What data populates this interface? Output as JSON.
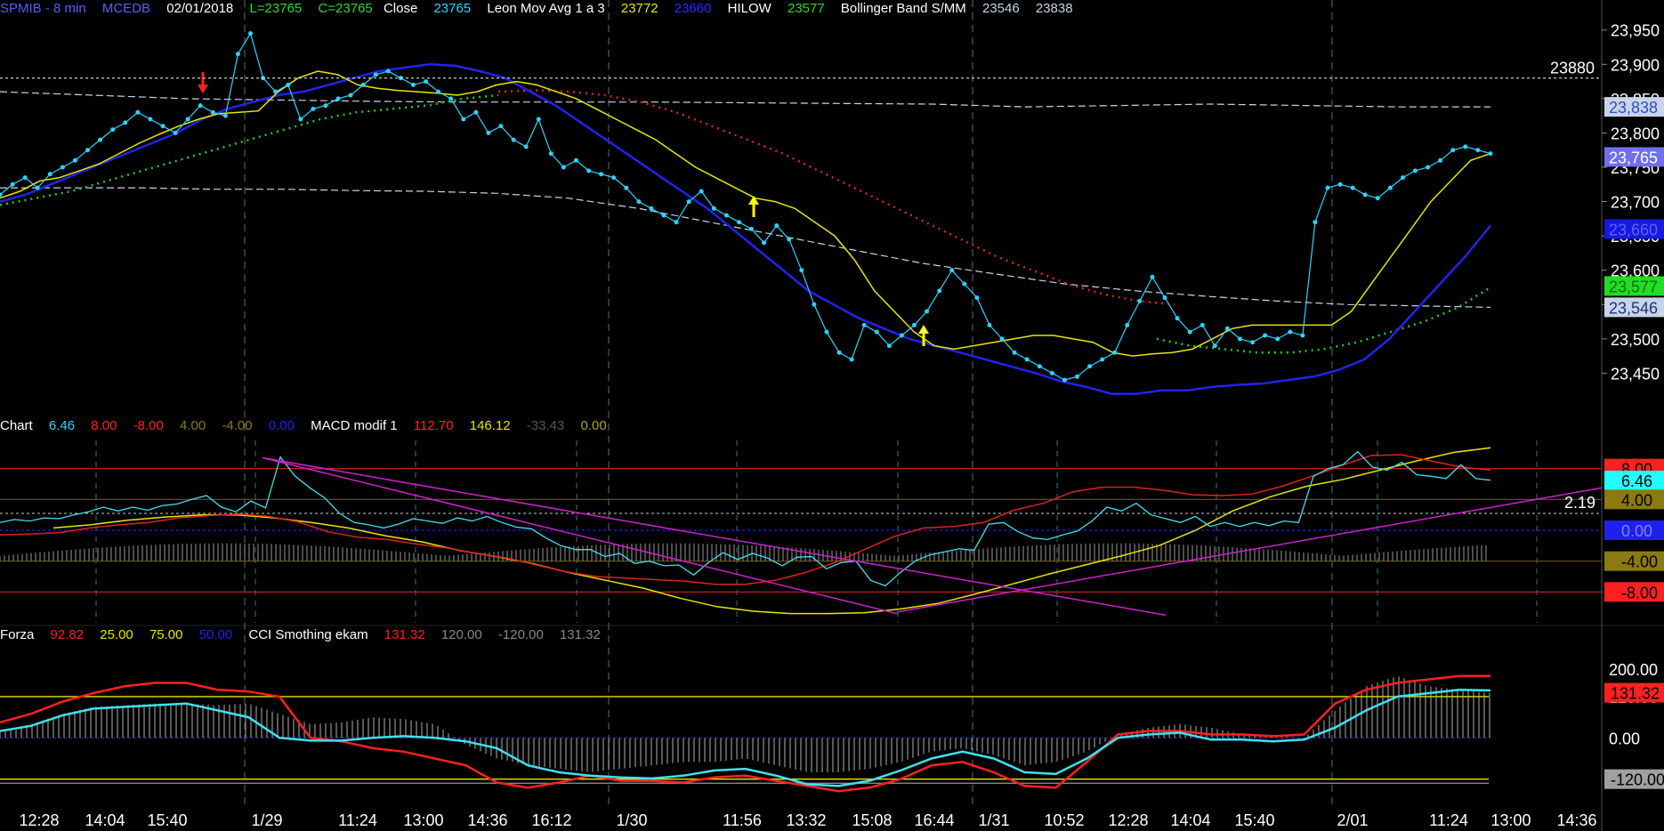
{
  "colors": {
    "background": "#000000",
    "grid": "#3a4a50",
    "price": "#2ad4ff",
    "leon": "#e6e600",
    "hilow": "#2222ee",
    "boll_up": "#dd2222",
    "boll_dn": "#22cc22",
    "band": "#c8d4e8",
    "magenta": "#d020d0",
    "cci": "#40e0f0",
    "forza_red": "#ff2020",
    "histogram": "#b0b0b0",
    "macd_red": "#dd2222"
  },
  "header_top": {
    "symbol": "SPMIB - 8 min",
    "exchange": "MCEDB",
    "date": "02/01/2018",
    "low": "L=23765",
    "close_lbl": "C=23765",
    "close_word": "Close",
    "close_val": "23765",
    "leon": "Leon Mov Avg 1 a 3",
    "leon_v1": "23772",
    "leon_v2": "23660",
    "hilow": "HILOW",
    "hilow_v": "23577",
    "boll": "Bollinger Band S/MM",
    "boll_v1": "23546",
    "boll_v2": "23838"
  },
  "header_mid": {
    "name": "Chart",
    "v1": "6.46",
    "v2": "8.00",
    "v3": "-8.00",
    "v4": "4.00",
    "v5": "-4.00",
    "v6": "0.00",
    "name2": "MACD modif 1",
    "m1": "112.70",
    "m2": "146.12",
    "m3": "-33.43",
    "m4": "0.00"
  },
  "header_bot": {
    "name": "Forza",
    "f1": "92.82",
    "f2": "25.00",
    "f3": "75.00",
    "f4": "50.00",
    "name2": "CCI Smothing ekam",
    "c1": "131.32",
    "c2": "120.00",
    "c3": "-120.00",
    "c4": "131.32"
  },
  "x_axis_labels": [
    "12:28",
    "14:04",
    "15:40",
    "1/29",
    "11:24",
    "13:00",
    "14:36",
    "16:12",
    "1/30",
    "11:56",
    "13:32",
    "15:08",
    "16:44",
    "1/31",
    "10:52",
    "12:28",
    "14:04",
    "15:40",
    "2/01",
    "11:24",
    "13:00",
    "14:36"
  ],
  "chart_data": [
    {
      "type": "line",
      "panel": "price",
      "ylim": [
        23400,
        23960
      ],
      "y_ticks": [
        "23,950",
        "23,900",
        "23,850",
        "23,800",
        "23,750",
        "23,700",
        "23,650",
        "23,600",
        "23,550",
        "23,500",
        "23,450"
      ],
      "reference_line": {
        "value": 23880,
        "label": "23880"
      },
      "price_tags": [
        {
          "value": 23838,
          "label": "23,838",
          "color": "#c8d4e8",
          "text": "#3050c0"
        },
        {
          "value": 23765,
          "label": "23,765",
          "color": "#7070ee",
          "text": "#ffffff"
        },
        {
          "value": 23660,
          "label": "23,660",
          "color": "#1818e0",
          "text": "#6060ff"
        },
        {
          "value": 23577,
          "label": "23,577",
          "color": "#22dd22",
          "text": "#107010"
        },
        {
          "value": 23546,
          "label": "23,546",
          "color": "#c8d4e8",
          "text": "#203080"
        }
      ],
      "series": [
        {
          "key": "close",
          "style": "dots",
          "values": [
            23710,
            23725,
            23735,
            23720,
            23740,
            23750,
            23760,
            23775,
            23790,
            23805,
            23815,
            23830,
            23820,
            23810,
            23800,
            23820,
            23840,
            23830,
            23825,
            23915,
            23945,
            23880,
            23860,
            23870,
            23820,
            23835,
            23840,
            23850,
            23855,
            23870,
            23885,
            23890,
            23880,
            23870,
            23875,
            23860,
            23850,
            23820,
            23830,
            23800,
            23810,
            23790,
            23780,
            23820,
            23770,
            23750,
            23760,
            23745,
            23740,
            23735,
            23720,
            23700,
            23690,
            23680,
            23670,
            23700,
            23715,
            23690,
            23680,
            23670,
            23660,
            23640,
            23665,
            23645,
            23600,
            23550,
            23510,
            23480,
            23470,
            23520,
            23510,
            23490,
            23505,
            23520,
            23540,
            23570,
            23600,
            23580,
            23560,
            23520,
            23500,
            23480,
            23470,
            23460,
            23450,
            23440,
            23445,
            23460,
            23470,
            23480,
            23520,
            23555,
            23590,
            23560,
            23530,
            23510,
            23520,
            23490,
            23515,
            23500,
            23495,
            23505,
            23500,
            23510,
            23505,
            23670,
            23720,
            23725,
            23720,
            23710,
            23705,
            23720,
            23735,
            23745,
            23750,
            23760,
            23775,
            23780,
            23775,
            23770
          ]
        },
        {
          "key": "leon",
          "style": "solid",
          "values": [
            23705,
            23715,
            23730,
            23735,
            23745,
            23755,
            23770,
            23785,
            23798,
            23810,
            23820,
            23828,
            23830,
            23832,
            23860,
            23880,
            23890,
            23885,
            23870,
            23865,
            23862,
            23860,
            23858,
            23855,
            23860,
            23870,
            23875,
            23870,
            23860,
            23850,
            23835,
            23820,
            23805,
            23790,
            23770,
            23750,
            23735,
            23720,
            23705,
            23700,
            23690,
            23670,
            23650,
            23615,
            23570,
            23540,
            23510,
            23490,
            23485,
            23490,
            23495,
            23500,
            23505,
            23505,
            23500,
            23495,
            23480,
            23475,
            23478,
            23480,
            23485,
            23500,
            23515,
            23520,
            23520,
            23520,
            23520,
            23520,
            23540,
            23580,
            23620,
            23660,
            23700,
            23730,
            23760,
            23770
          ]
        },
        {
          "key": "hilow",
          "style": "solid",
          "values": [
            23700,
            23710,
            23725,
            23740,
            23755,
            23770,
            23785,
            23800,
            23820,
            23835,
            23845,
            23855,
            23860,
            23870,
            23880,
            23890,
            23895,
            23900,
            23898,
            23890,
            23880,
            23860,
            23840,
            23815,
            23790,
            23765,
            23740,
            23715,
            23690,
            23660,
            23630,
            23600,
            23570,
            23550,
            23530,
            23515,
            23500,
            23490,
            23480,
            23470,
            23460,
            23450,
            23438,
            23430,
            23420,
            23420,
            23425,
            23425,
            23430,
            23433,
            23435,
            23440,
            23445,
            23455,
            23470,
            23500,
            23540,
            23580,
            23620,
            23665
          ]
        },
        {
          "key": "boll_up",
          "style": "dotted",
          "values": [
            23860,
            23862,
            23860,
            23855,
            23845,
            23830,
            23810,
            23790,
            23770,
            23745,
            23720,
            23695,
            23670,
            23645,
            23620,
            23600,
            23580,
            23565,
            23555,
            23550
          ]
        },
        {
          "key": "boll_dn",
          "style": "dotted",
          "values": [
            23695,
            23705,
            23715,
            23730,
            23745,
            23760,
            23775,
            23790,
            23805,
            23820,
            23830,
            23835,
            23840,
            23850,
            23855
          ]
        },
        {
          "key": "boll_dn2",
          "style": "dotted",
          "values": [
            23500,
            23490,
            23485,
            23480,
            23480,
            23485,
            23495,
            23510,
            23525,
            23545,
            23575
          ]
        },
        {
          "key": "band_upper",
          "style": "dashed",
          "values": [
            23860,
            23855,
            23850,
            23848,
            23846,
            23845,
            23845,
            23845,
            23844,
            23843,
            23842,
            23838,
            23840,
            23842,
            23840,
            23838,
            23838
          ]
        },
        {
          "key": "band_lower",
          "style": "dashed",
          "values": [
            23720,
            23720,
            23720,
            23718,
            23718,
            23716,
            23715,
            23712,
            23705,
            23690,
            23670,
            23650,
            23630,
            23610,
            23595,
            23580,
            23570,
            23562,
            23555,
            23550,
            23548,
            23546
          ]
        }
      ],
      "markers": [
        {
          "type": "down-arrow",
          "color": "#ff2020"
        },
        {
          "type": "up-arrow",
          "color": "#ffff00"
        },
        {
          "type": "up-arrow",
          "color": "#ffff00"
        }
      ]
    },
    {
      "type": "line",
      "panel": "chart_macd",
      "ylim": [
        -12,
        12
      ],
      "y_ticks": [
        {
          "value": 8,
          "label": "8.00",
          "bg": "#ff2020",
          "fg": "#000000"
        },
        {
          "value": 6.46,
          "label": "6.46",
          "bg": "#22ffff",
          "fg": "#000000"
        },
        {
          "value": 4,
          "label": "4.00",
          "bg": "#8a7a10",
          "fg": "#000000"
        },
        {
          "value": 0,
          "label": "0.00",
          "bg": "#2020ee",
          "fg": "#8080ff"
        },
        {
          "value": -4,
          "label": "-4.00",
          "bg": "#8a7a10",
          "fg": "#000000"
        },
        {
          "value": -8,
          "label": "-8.00",
          "bg": "#ff2020",
          "fg": "#000000"
        }
      ],
      "reference_line": {
        "value": 2.19,
        "label": "2.19"
      },
      "series": [
        {
          "key": "cyan",
          "values": [
            1,
            1.4,
            1.2,
            1.6,
            1.5,
            2,
            2.4,
            3,
            2.5,
            3,
            2.6,
            3.2,
            3.4,
            4,
            4.5,
            3,
            2.4,
            3.8,
            2.9,
            9.5,
            7,
            5.5,
            4.2,
            2.2,
            1,
            0.7,
            0.3,
            0.8,
            1.5,
            1.2,
            0.9,
            1.6,
            1.2,
            1.8,
            1,
            0.4,
            0.2,
            -1,
            -2,
            -2.5,
            -2.5,
            -3.4,
            -3,
            -4.3,
            -4,
            -4.6,
            -4.5,
            -5.8,
            -4.2,
            -2.9,
            -3.8,
            -3,
            -3.6,
            -4.6,
            -3.5,
            -3.4,
            -5,
            -4.2,
            -4,
            -6.5,
            -7.2,
            -5.5,
            -4,
            -3.2,
            -2.8,
            -2.4,
            -2.6,
            0.8,
            1,
            -0.2,
            -1,
            -1.2,
            -0.6,
            -0.1,
            1.2,
            3,
            2.5,
            3.5,
            2,
            1.5,
            1,
            1.8,
            0.5,
            1,
            0.5,
            1,
            0.6,
            1.2,
            1,
            7,
            8,
            8.5,
            10.2,
            8.2,
            7.8,
            8.8,
            7.2,
            7,
            6.7,
            8.5,
            6.7,
            6.5
          ]
        },
        {
          "key": "red",
          "values": [
            -0.6,
            -0.5,
            -0.3,
            0.3,
            0.7,
            1,
            1.6,
            1.9,
            2.1,
            1.8,
            1.1,
            -0.2,
            -0.9,
            -1.2,
            -1.8,
            -2.3,
            -3,
            -3.6,
            -4.5,
            -5.4,
            -6,
            -6.2,
            -6.4,
            -6.6,
            -7,
            -7,
            -6.5,
            -5.5,
            -4.2,
            -2.5,
            -0.8,
            0.3,
            0.5,
            1,
            2.6,
            3.5,
            5,
            5.6,
            5.6,
            5.2,
            4.6,
            4.5,
            4.7,
            5.7,
            7,
            8.4,
            9.7,
            9.8,
            9,
            8.2,
            7.8
          ]
        },
        {
          "key": "yellow",
          "values": [
            0.3,
            0.7,
            1.3,
            1.7,
            2,
            2,
            1.6,
            1,
            0.3,
            -0.7,
            -1.5,
            -2.6,
            -3.4,
            -4.3,
            -5.5,
            -6.5,
            -7.5,
            -8.8,
            -9.9,
            -10.5,
            -10.8,
            -10.8,
            -10.7,
            -10.2,
            -9.5,
            -8.3,
            -7,
            -5.7,
            -4.5,
            -3.3,
            -2,
            0,
            2.5,
            4.3,
            5.7,
            6.6,
            7.8,
            9,
            10.1,
            10.7
          ]
        },
        {
          "key": "magenta1",
          "values": [
            9.4,
            -10.8
          ]
        },
        {
          "key": "magenta2",
          "values": [
            9.4,
            -11
          ]
        },
        {
          "key": "magenta3",
          "values": [
            -10.6,
            5.5
          ]
        }
      ]
    },
    {
      "type": "line",
      "panel": "forza_cci",
      "ylim": [
        -170,
        270
      ],
      "y_ticks": [
        {
          "value": 200,
          "label": "200.00"
        },
        {
          "value": 120,
          "label": "120.00"
        },
        {
          "value": 0,
          "label": "0.00"
        },
        {
          "value": -120,
          "label": "-120.00"
        }
      ],
      "value_tags": [
        {
          "value": 131.32,
          "label": "131.32",
          "bg": "#ff2020",
          "fg": "#000000"
        },
        {
          "value": -120,
          "label": "-120.00",
          "bg": "#a0a0a0",
          "fg": "#000000"
        }
      ],
      "series": [
        {
          "key": "cci",
          "values": [
            20,
            35,
            65,
            85,
            90,
            95,
            100,
            80,
            60,
            0,
            -8,
            -8,
            0,
            5,
            0,
            -10,
            -30,
            -80,
            -100,
            -110,
            -115,
            -118,
            -110,
            -95,
            -90,
            -110,
            -135,
            -140,
            -125,
            -95,
            -60,
            -40,
            -60,
            -100,
            -105,
            -60,
            0,
            10,
            15,
            -5,
            -5,
            -10,
            -5,
            30,
            80,
            120,
            130,
            140,
            138
          ]
        },
        {
          "key": "forza",
          "values": [
            45,
            70,
            105,
            130,
            150,
            160,
            160,
            140,
            135,
            120,
            0,
            -10,
            -30,
            -40,
            -60,
            -80,
            -130,
            -145,
            -130,
            -110,
            -125,
            -125,
            -130,
            -115,
            -110,
            -125,
            -140,
            -155,
            -145,
            -120,
            -80,
            -70,
            -100,
            -140,
            -145,
            -70,
            10,
            20,
            20,
            10,
            10,
            5,
            10,
            100,
            140,
            160,
            170,
            180,
            180
          ]
        },
        {
          "key": "histogram",
          "values": [
            20,
            40,
            70,
            90,
            95,
            100,
            100,
            95,
            100,
            70,
            40,
            45,
            60,
            55,
            40,
            -20,
            -60,
            -80,
            -90,
            -100,
            -90,
            -80,
            -70,
            -70,
            -60,
            -80,
            -100,
            -100,
            -90,
            -70,
            -40,
            -30,
            -50,
            -80,
            -70,
            -40,
            10,
            30,
            40,
            30,
            10,
            5,
            0,
            80,
            150,
            180,
            150,
            140,
            130
          ]
        }
      ]
    }
  ]
}
